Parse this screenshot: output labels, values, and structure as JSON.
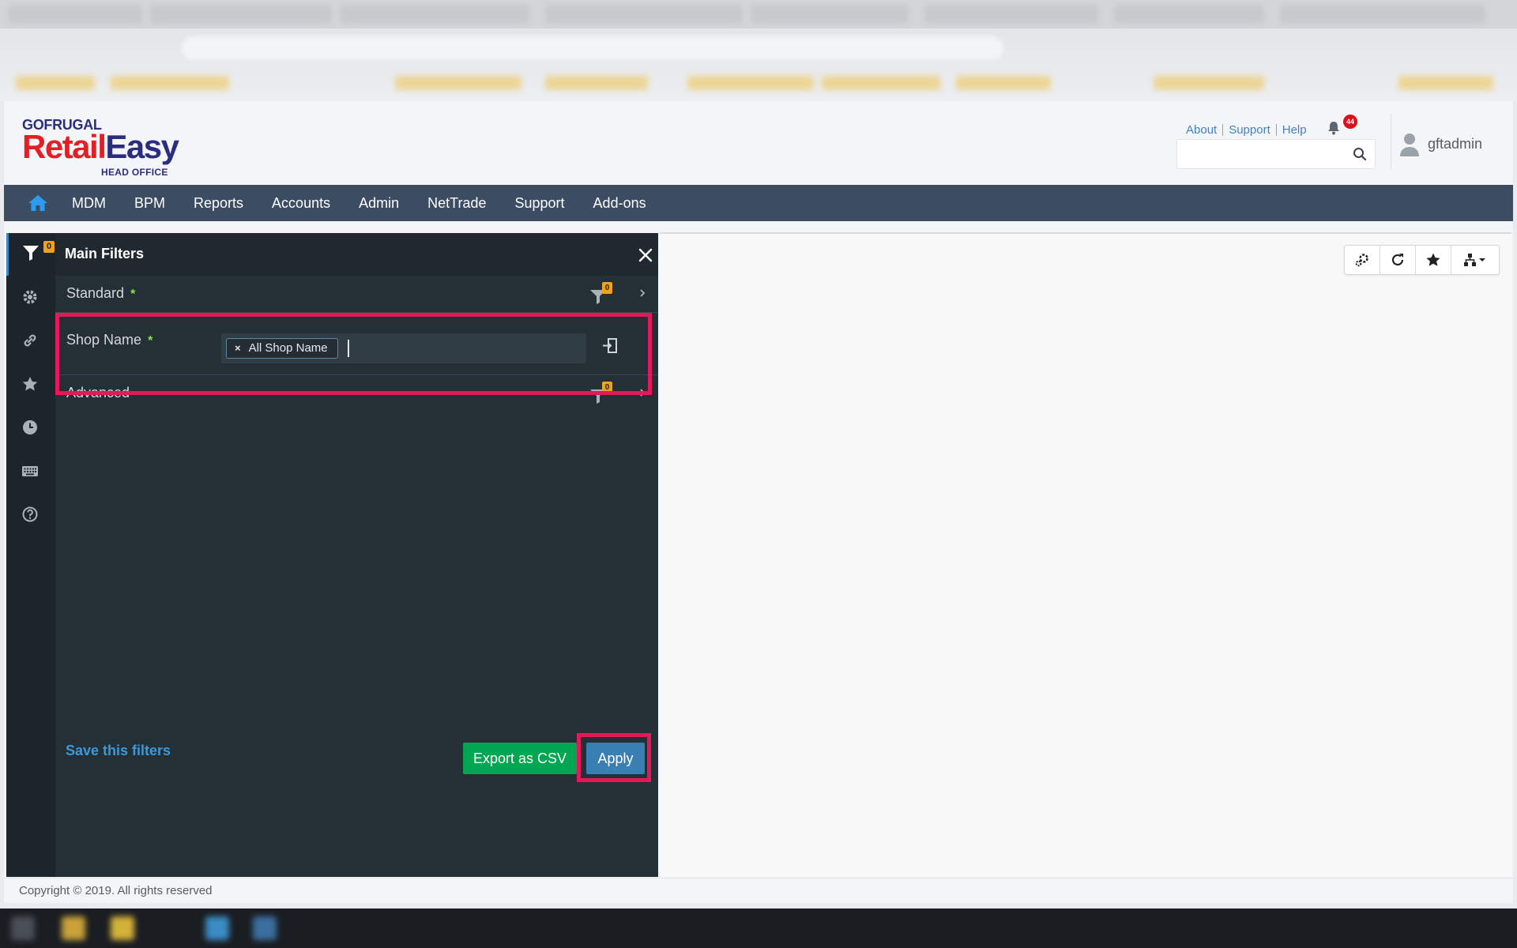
{
  "app": {
    "logo": {
      "brand": "GOFRUGAL",
      "product_part1": "Retail",
      "product_part2": "Easy",
      "edition": "HEAD OFFICE"
    },
    "top_links": [
      "About",
      "Support",
      "Help"
    ],
    "notification_count": "44",
    "search": {
      "placeholder": "",
      "value": ""
    },
    "user": {
      "name": "gftadmin"
    },
    "colors": {
      "nav_bg": "#3c4c62",
      "panel_bg": "#252f36",
      "accent": "#3a86c8",
      "badge": "#f0a21b",
      "highlight": "#e5195a",
      "export_btn": "#00a651",
      "apply_btn": "#3a7fb3"
    }
  },
  "nav": {
    "home_icon": "home-icon",
    "items": [
      "MDM",
      "BPM",
      "Reports",
      "Accounts",
      "Admin",
      "NetTrade",
      "Support",
      "Add-ons"
    ]
  },
  "filter_panel": {
    "title": "Main Filters",
    "filter_count": "0",
    "rail_icons": [
      "filter-icon",
      "gear-icon",
      "link-icon",
      "star-icon",
      "clock-icon",
      "keyboard-icon",
      "help-icon"
    ],
    "sections": {
      "standard": {
        "label": "Standard",
        "required_mark": "*",
        "count": "0"
      },
      "advanced": {
        "label": "Advanced",
        "count": "0"
      }
    },
    "shop_name": {
      "label": "Shop Name",
      "required_mark": "*",
      "tags": [
        {
          "remove": "×",
          "text": "All Shop Name"
        }
      ],
      "input_value": ""
    },
    "save_label": "Save this filters",
    "export_label": "Export as CSV",
    "apply_label": "Apply"
  },
  "content_toolbar": {
    "icons": [
      "settings-cog-icon",
      "refresh-icon",
      "star-icon",
      "hierarchy-dropdown-icon"
    ]
  },
  "footer": {
    "copyright": "Copyright © 2019. All rights reserved"
  }
}
